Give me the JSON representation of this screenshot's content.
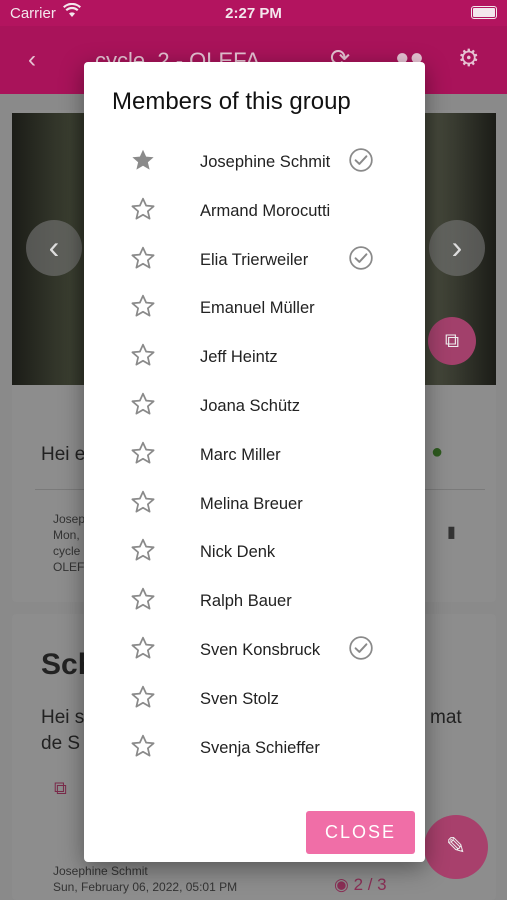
{
  "status_bar": {
    "carrier": "Carrier",
    "time": "2:27 PM"
  },
  "app_bar": {
    "title": "cycle_2 - OLEFA"
  },
  "post1": {
    "text_start": "Hei e",
    "meta": [
      "Josep",
      "Mon,",
      "cycle",
      "OLEF"
    ]
  },
  "post2": {
    "title_start": "Sch",
    "text_line1_start": "Hei s",
    "text_line1_end": "mat",
    "text_line2_start": "de S",
    "author": "Josephine Schmit",
    "date": "Sun, February 06, 2022, 05:01 PM",
    "views": "2 / 3"
  },
  "dialog": {
    "title": "Members of this group",
    "close_label": "CLOSE",
    "members": [
      {
        "name": "Josephine Schmit",
        "starred": true,
        "checked": true
      },
      {
        "name": "Armand Morocutti",
        "starred": false,
        "checked": false
      },
      {
        "name": "Elia Trierweiler",
        "starred": false,
        "checked": true
      },
      {
        "name": "Emanuel Müller",
        "starred": false,
        "checked": false
      },
      {
        "name": "Jeff Heintz",
        "starred": false,
        "checked": false
      },
      {
        "name": "Joana Schütz",
        "starred": false,
        "checked": false
      },
      {
        "name": "Marc Miller",
        "starred": false,
        "checked": false
      },
      {
        "name": "Melina Breuer",
        "starred": false,
        "checked": false
      },
      {
        "name": "Nick Denk",
        "starred": false,
        "checked": false
      },
      {
        "name": "Ralph Bauer",
        "starred": false,
        "checked": false
      },
      {
        "name": "Sven Konsbruck",
        "starred": false,
        "checked": true
      },
      {
        "name": "Sven Stolz",
        "starred": false,
        "checked": false
      },
      {
        "name": "Svenja Schieffer",
        "starred": false,
        "checked": false
      }
    ]
  },
  "colors": {
    "accent": "#f06ea7",
    "icon_gray": "#8a8a8a",
    "brand": "#c2185b"
  }
}
